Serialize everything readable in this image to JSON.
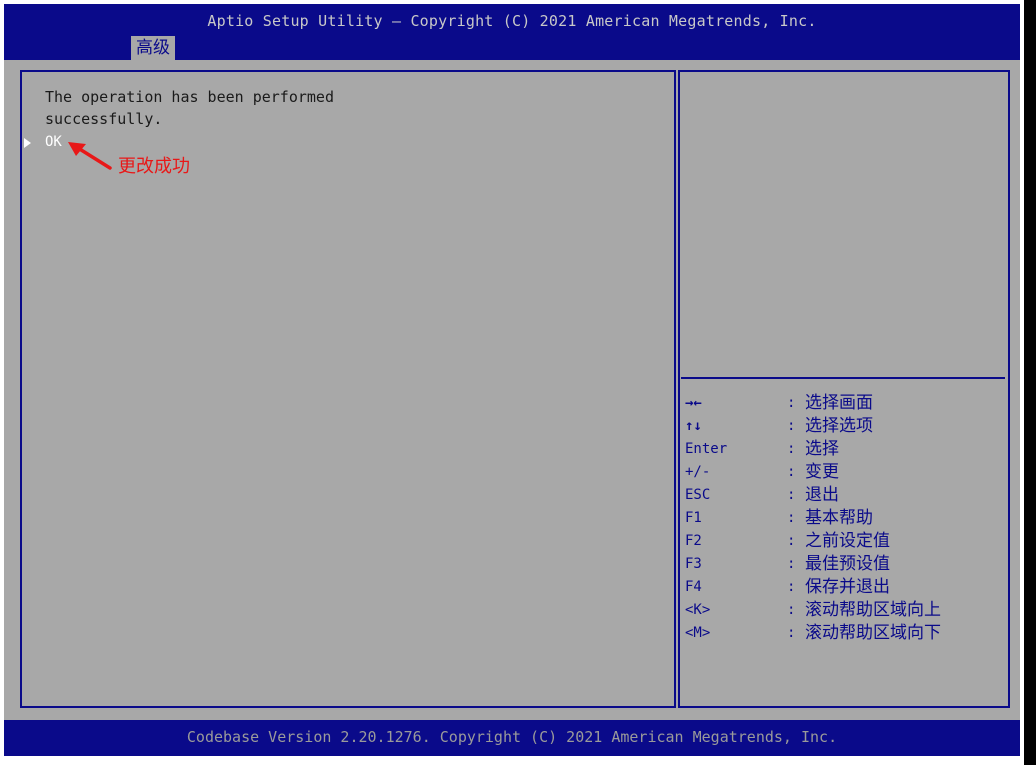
{
  "header": {
    "title": "Aptio Setup Utility – Copyright (C) 2021 American Megatrends, Inc.",
    "active_tab": "高级"
  },
  "main": {
    "message": "The operation has been performed successfully.",
    "ok_option": "OK",
    "annotation": "更改成功"
  },
  "help": {
    "legend": [
      {
        "key": "→←",
        "sep": ":",
        "desc": "选择画面"
      },
      {
        "key": "↑↓",
        "sep": ":",
        "desc": "选择选项"
      },
      {
        "key": "Enter",
        "sep": ":",
        "desc": "选择"
      },
      {
        "key": "+/-",
        "sep": ":",
        "desc": "变更"
      },
      {
        "key": "ESC",
        "sep": ":",
        "desc": "退出"
      },
      {
        "key": "F1",
        "sep": ":",
        "desc": "基本帮助"
      },
      {
        "key": "F2",
        "sep": ":",
        "desc": "之前设定值"
      },
      {
        "key": "F3",
        "sep": ":",
        "desc": "最佳预设值"
      },
      {
        "key": "F4",
        "sep": ":",
        "desc": "保存并退出"
      },
      {
        "key": "<K>",
        "sep": ":",
        "desc": "滚动帮助区域向上"
      },
      {
        "key": "<M>",
        "sep": ":",
        "desc": "滚动帮助区域向下"
      }
    ]
  },
  "footer": {
    "text": "Codebase Version 2.20.1276. Copyright (C) 2021 American Megatrends, Inc."
  },
  "colors": {
    "bios_blue": "#0a0a8a",
    "panel_gray": "#a8a8a8",
    "annotation_red": "#e81818"
  }
}
